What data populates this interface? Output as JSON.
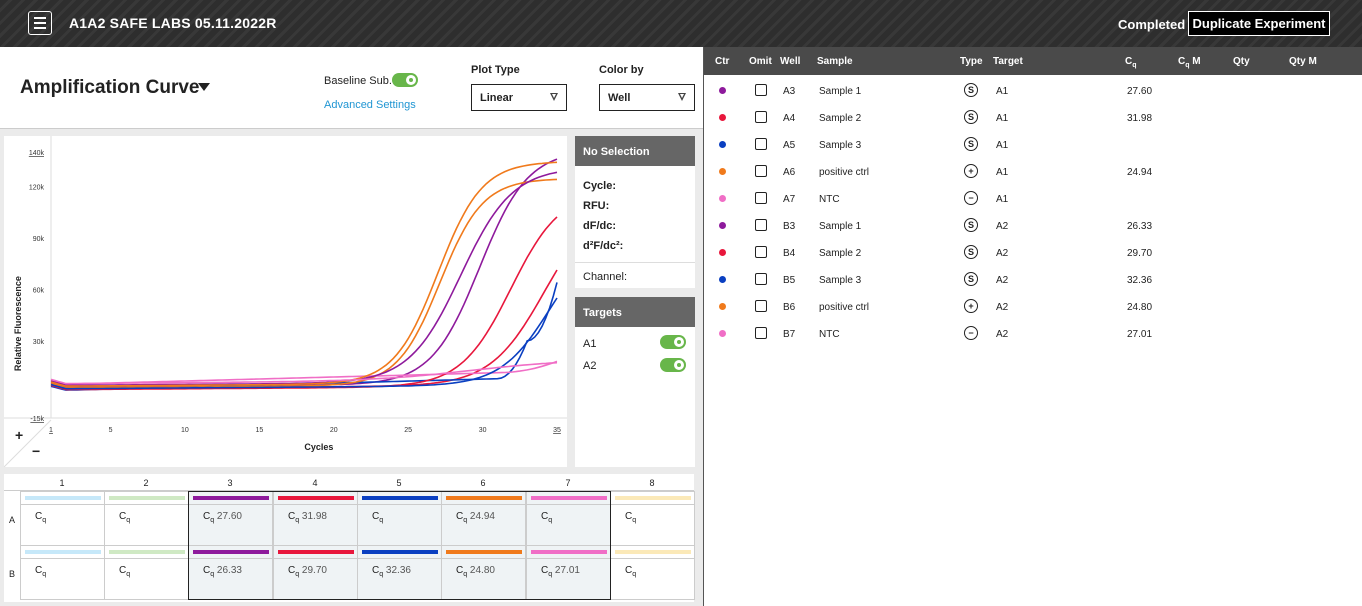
{
  "header": {
    "menu_icon": "hamburger-menu-icon",
    "title": "A1A2 SAFE LABS 05.11.2022R",
    "status": "Completed",
    "duplicate_label": "Duplicate Experiment"
  },
  "plot_controls": {
    "title": "Amplification Curve",
    "baseline_label": "Baseline Sub.",
    "baseline_on": true,
    "advanced_label": "Advanced Settings",
    "plot_type_label": "Plot Type",
    "plot_type_value": "Linear",
    "color_by_label": "Color by",
    "color_by_value": "Well",
    "accent_color": "#2196d3",
    "toggle_color": "#68b64a"
  },
  "selection": {
    "title": "No Selection",
    "cycle_label": "Cycle:",
    "rfu_label": "RFU:",
    "df_label": "dF/dc:",
    "d2f_label": "d²F/dc²:",
    "channel_label": "Channel:"
  },
  "targets_panel": {
    "title": "Targets",
    "items": [
      {
        "label": "A1",
        "on": true
      },
      {
        "label": "A2",
        "on": true
      }
    ]
  },
  "zoom": {
    "in": "+",
    "out": "−"
  },
  "chart_data": {
    "type": "line",
    "ylabel": "Relative Fluorescence",
    "xlabel": "Cycles",
    "x_ticks": [
      "1",
      "5",
      "10",
      "15",
      "20",
      "25",
      "30",
      "35"
    ],
    "y_ticks": [
      "140k",
      "120k",
      "90k",
      "60k",
      "30k",
      "-15k"
    ],
    "xlim": [
      1,
      35
    ],
    "ylim": [
      -15000,
      140000
    ],
    "series": [
      {
        "color": "#8e1a9c",
        "cq": 27.6,
        "plateau": 136000,
        "k": 0.62,
        "base": 3000
      },
      {
        "color": "#e8173c",
        "cq": 31.98,
        "plateau": 110000,
        "k": 0.55,
        "base": 2000
      },
      {
        "color": "#0a3fc1",
        "cq": null,
        "plateau": 0,
        "k": 0,
        "base": 1000,
        "slope": 230,
        "tail": [
          [
            33,
            30000
          ],
          [
            35,
            64000
          ]
        ]
      },
      {
        "color": "#f07a1c",
        "cq": 24.94,
        "plateau": 120000,
        "k": 0.7,
        "base": 2500
      },
      {
        "color": "#f06ec6",
        "cq": null,
        "plateau": 0,
        "k": 0,
        "base": 4500,
        "slope": 230,
        "tail": [
          [
            35,
            18000
          ]
        ]
      },
      {
        "color": "#8e1a9c",
        "cq": 26.33,
        "plateau": 125000,
        "k": 0.58,
        "base": 4000
      },
      {
        "color": "#e8173c",
        "cq": 29.7,
        "plateau": 114000,
        "k": 0.6,
        "base": 1500
      },
      {
        "color": "#0a3fc1",
        "cq": 32.36,
        "plateau": 90000,
        "k": 0.6,
        "base": 2000
      },
      {
        "color": "#f07a1c",
        "cq": 24.8,
        "plateau": 129000,
        "k": 0.68,
        "base": 3500
      },
      {
        "color": "#f06ec6",
        "cq": 27.01,
        "plateau": 12000,
        "k": 0.3,
        "base": 5000
      }
    ]
  },
  "plate": {
    "columns": [
      "1",
      "2",
      "3",
      "4",
      "5",
      "6",
      "7",
      "8"
    ],
    "rows": [
      "A",
      "B"
    ],
    "cq_symbol": "C",
    "cq_sub": "q",
    "bar_colors": [
      "#c6e8f9",
      "#cfe9c4",
      "#8e1a9c",
      "#e8173c",
      "#0a3fc1",
      "#f07a1c",
      "#f06ec6",
      "#fbe9b8"
    ],
    "values": [
      [
        "",
        "",
        "27.60",
        "31.98",
        "",
        "24.94",
        "",
        ""
      ],
      [
        "",
        "",
        "26.33",
        "29.70",
        "32.36",
        "24.80",
        "27.01",
        ""
      ]
    ]
  },
  "table": {
    "columns": {
      "ctr": "Ctr",
      "omit": "Omit",
      "well": "Well",
      "sample": "Sample",
      "type": "Type",
      "target": "Target",
      "cq": "C",
      "cq_sub": "q",
      "cqm_pre": "C",
      "cqm_sub": "q",
      "cqm_post": " M",
      "qty": "Qty",
      "qtym": "Qty M"
    },
    "rows": [
      {
        "color": "#8e1a9c",
        "well": "A3",
        "sample": "Sample 1",
        "type": "S",
        "target": "A1",
        "cq": "27.60"
      },
      {
        "color": "#e8173c",
        "well": "A4",
        "sample": "Sample 2",
        "type": "S",
        "target": "A1",
        "cq": "31.98"
      },
      {
        "color": "#0a3fc1",
        "well": "A5",
        "sample": "Sample 3",
        "type": "S",
        "target": "A1",
        "cq": ""
      },
      {
        "color": "#f07a1c",
        "well": "A6",
        "sample": "positive ctrl",
        "type": "+",
        "target": "A1",
        "cq": "24.94"
      },
      {
        "color": "#f06ec6",
        "well": "A7",
        "sample": "NTC",
        "type": "−",
        "target": "A1",
        "cq": ""
      },
      {
        "color": "#8e1a9c",
        "well": "B3",
        "sample": "Sample 1",
        "type": "S",
        "target": "A2",
        "cq": "26.33"
      },
      {
        "color": "#e8173c",
        "well": "B4",
        "sample": "Sample 2",
        "type": "S",
        "target": "A2",
        "cq": "29.70"
      },
      {
        "color": "#0a3fc1",
        "well": "B5",
        "sample": "Sample 3",
        "type": "S",
        "target": "A2",
        "cq": "32.36"
      },
      {
        "color": "#f07a1c",
        "well": "B6",
        "sample": "positive ctrl",
        "type": "+",
        "target": "A2",
        "cq": "24.80"
      },
      {
        "color": "#f06ec6",
        "well": "B7",
        "sample": "NTC",
        "type": "−",
        "target": "A2",
        "cq": "27.01"
      }
    ]
  }
}
